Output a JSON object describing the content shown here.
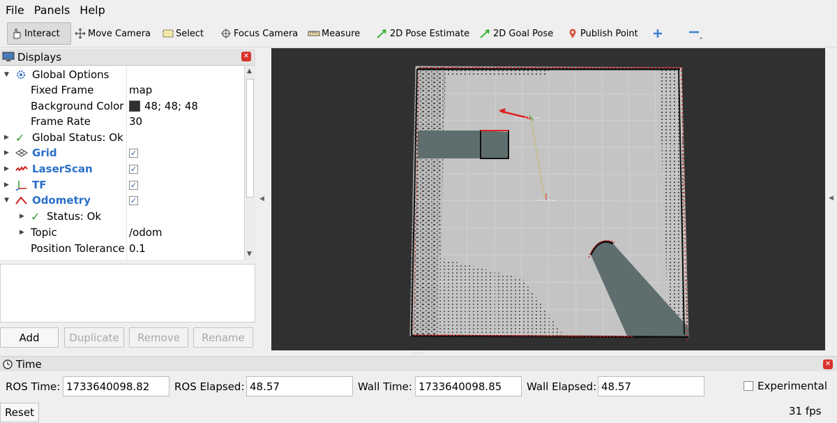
{
  "menubar": {
    "items": [
      "File",
      "Panels",
      "Help"
    ]
  },
  "toolbar": {
    "tools": [
      {
        "label": "Interact",
        "icon": "hand-icon",
        "active": true
      },
      {
        "label": "Move Camera",
        "icon": "move-camera-icon"
      },
      {
        "label": "Select",
        "icon": "select-icon"
      },
      {
        "label": "Focus Camera",
        "icon": "focus-camera-icon"
      },
      {
        "label": "Measure",
        "icon": "ruler-icon"
      },
      {
        "label": "2D Pose Estimate",
        "icon": "green-arrow-icon"
      },
      {
        "label": "2D Goal Pose",
        "icon": "green-arrow-icon"
      },
      {
        "label": "Publish Point",
        "icon": "map-pin-icon"
      }
    ],
    "add_icon": "plus-icon",
    "remove_icon": "minus-icon"
  },
  "displays": {
    "title": "Displays",
    "tree": {
      "global_options": {
        "label": "Global Options",
        "fixed_frame": {
          "label": "Fixed Frame",
          "value": "map"
        },
        "background_color": {
          "label": "Background Color",
          "value": "48; 48; 48",
          "swatch": "#303030"
        },
        "frame_rate": {
          "label": "Frame Rate",
          "value": "30"
        }
      },
      "global_status": "Global Status: Ok",
      "grid": {
        "label": "Grid",
        "checked": "✓"
      },
      "laserscan": {
        "label": "LaserScan",
        "checked": "✓"
      },
      "tf": {
        "label": "TF",
        "checked": "✓"
      },
      "odometry": {
        "label": "Odometry",
        "checked": "✓",
        "status": "Status: Ok",
        "topic": {
          "label": "Topic",
          "value": "/odom"
        },
        "position_tolerance": {
          "label": "Position Tolerance",
          "value": "0.1"
        }
      }
    },
    "buttons": {
      "add": "Add",
      "duplicate": "Duplicate",
      "remove": "Remove",
      "rename": "Rename"
    }
  },
  "viewport": {
    "background": "#303030"
  },
  "time": {
    "title": "Time",
    "ros_time": {
      "label": "ROS Time:",
      "value": "1733640098.82"
    },
    "ros_elapsed": {
      "label": "ROS Elapsed:",
      "value": "48.57"
    },
    "wall_time": {
      "label": "Wall Time:",
      "value": "1733640098.85"
    },
    "wall_elapsed": {
      "label": "Wall Elapsed:",
      "value": "48.57"
    },
    "experimental": "Experimental",
    "fps": "31 fps",
    "reset": "Reset"
  }
}
